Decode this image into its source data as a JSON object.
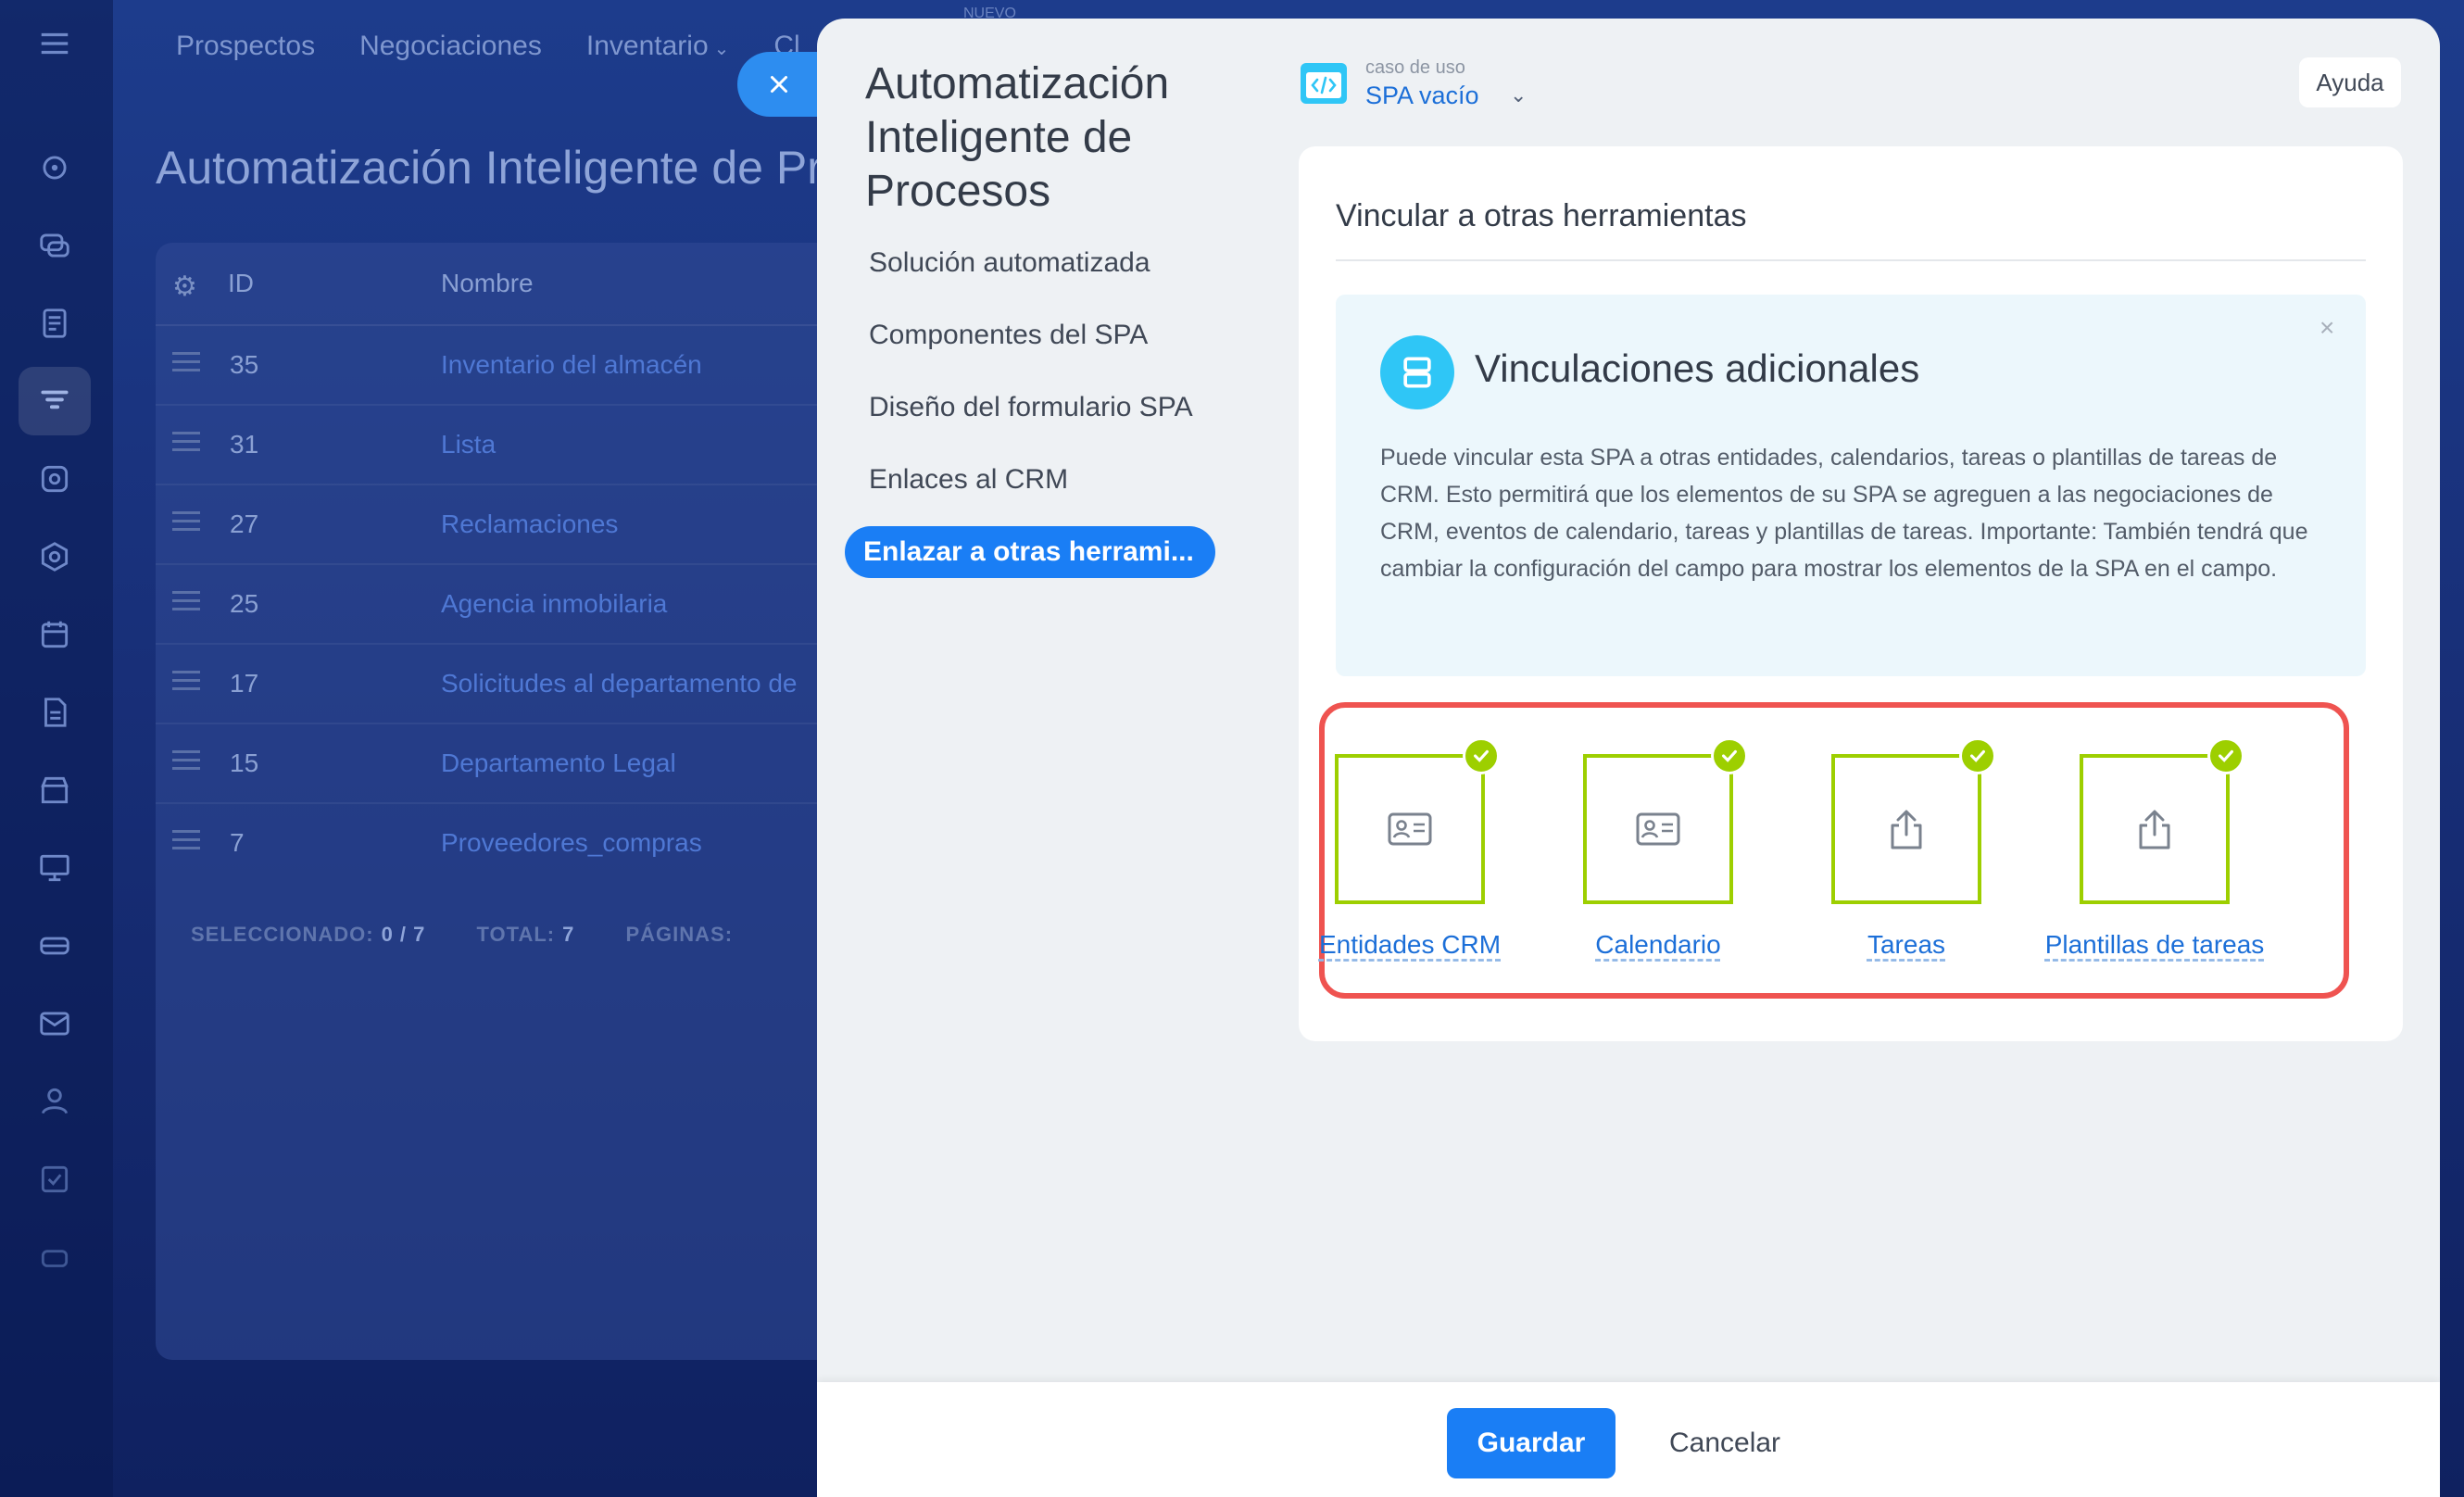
{
  "top_nav": {
    "items": [
      {
        "label": "Prospectos"
      },
      {
        "label": "Negociaciones"
      },
      {
        "label": "Inventario",
        "dropdown": true
      },
      {
        "label": "Cl"
      }
    ],
    "new_badge": "NUEVO"
  },
  "background_page": {
    "title": "Automatización Inteligente de Pr",
    "table": {
      "columns": [
        "ID",
        "Nombre"
      ],
      "rows": [
        {
          "id": "35",
          "name": "Inventario del almacén"
        },
        {
          "id": "31",
          "name": "Lista"
        },
        {
          "id": "27",
          "name": "Reclamaciones"
        },
        {
          "id": "25",
          "name": "Agencia inmobilaria"
        },
        {
          "id": "17",
          "name": "Solicitudes al departamento de"
        },
        {
          "id": "15",
          "name": "Departamento Legal"
        },
        {
          "id": "7",
          "name": "Proveedores_compras"
        }
      ],
      "footer": {
        "selected_label": "SELECCIONADO:",
        "selected_value": "0 / 7",
        "total_label": "TOTAL:",
        "total_value": "7",
        "pages_label": "PÁGINAS:"
      }
    }
  },
  "panel": {
    "title": "Automatización Inteligente de Procesos",
    "menu": [
      {
        "label": "Solución automatizada",
        "active": false
      },
      {
        "label": "Componentes del SPA",
        "active": false
      },
      {
        "label": "Diseño del formulario SPA",
        "active": false
      },
      {
        "label": "Enlaces al CRM",
        "active": false
      },
      {
        "label": "Enlazar a otras herrami...",
        "active": true
      }
    ],
    "use_case": {
      "label": "caso de uso",
      "value": "SPA vacío",
      "icon": "code-window-icon"
    },
    "help_label": "Ayuda",
    "card": {
      "title": "Vincular a otras herramientas",
      "info": {
        "title": "Vinculaciones adicionales",
        "text": "Puede vincular esta SPA a otras entidades, calendarios, tareas o plantillas de tareas de CRM. Esto permitirá que los elementos de su SPA se agreguen a las negociaciones de CRM, eventos de calendario, tareas y plantillas de tareas. Importante: También tendrá que cambiar la configuración del campo para mostrar los elementos de la SPA en el campo."
      },
      "tools": [
        {
          "label": "Entidades CRM",
          "icon": "id-card-icon",
          "checked": true
        },
        {
          "label": "Calendario",
          "icon": "id-card-icon",
          "checked": true
        },
        {
          "label": "Tareas",
          "icon": "share-upload-icon",
          "checked": true
        },
        {
          "label": "Plantillas de tareas",
          "icon": "share-upload-icon",
          "checked": true
        }
      ]
    },
    "footer": {
      "save_label": "Guardar",
      "cancel_label": "Cancelar"
    }
  },
  "colors": {
    "accent": "#1a7ef5",
    "check": "#9dcf00",
    "highlight": "#ef5350",
    "info_icon": "#2fc6f6"
  }
}
